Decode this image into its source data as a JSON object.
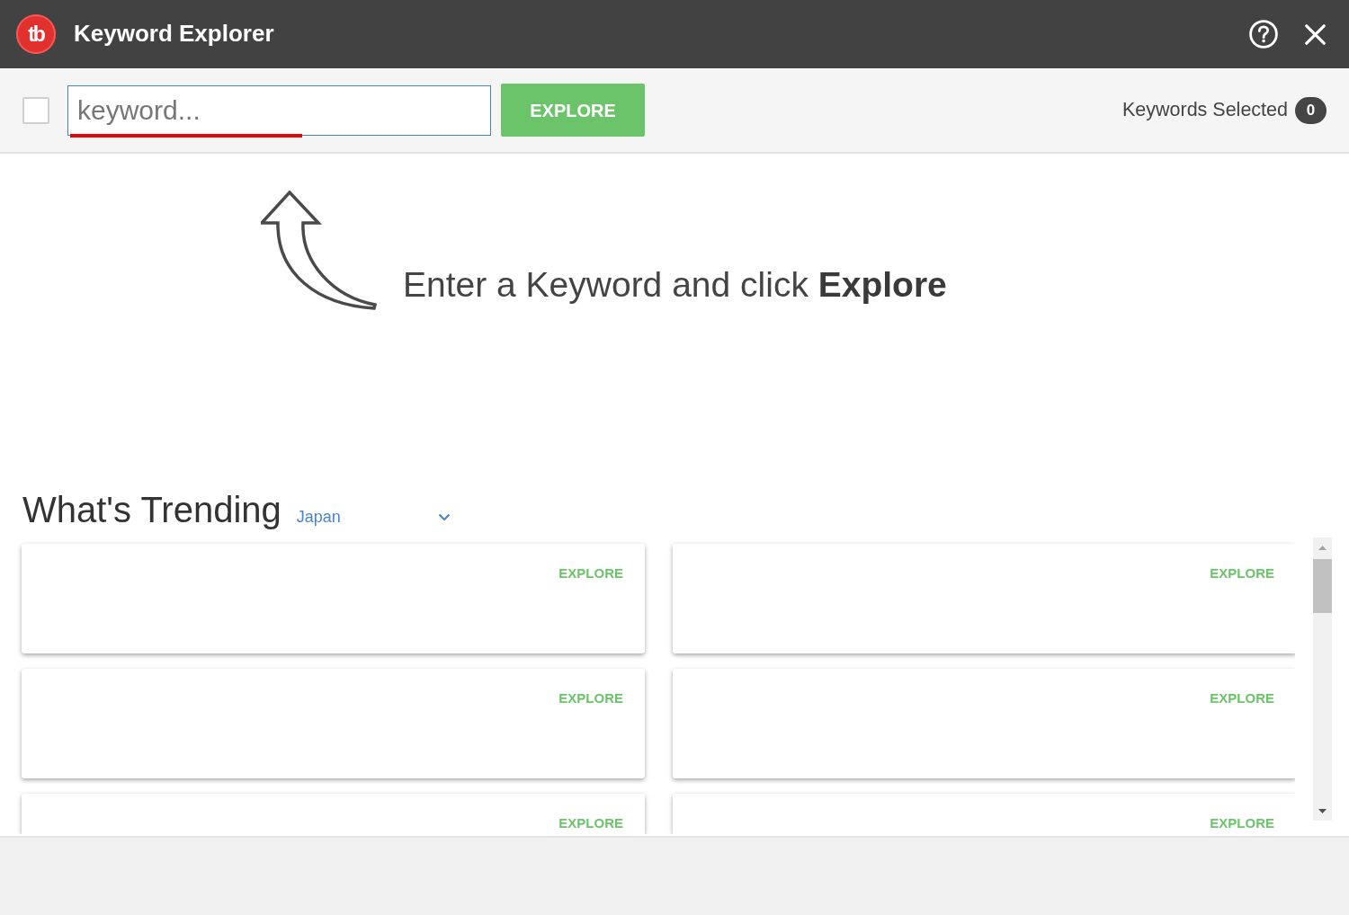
{
  "window": {
    "title": "Keyword Explorer",
    "logo_text": "tb"
  },
  "toolbar": {
    "select_all": {
      "checked": false
    },
    "search": {
      "placeholder": "keyword...",
      "underlined": true
    },
    "explore_button": "EXPLORE",
    "selected_label": "Keywords Selected",
    "selected_count": "0"
  },
  "hint": "Enter a Keyword and click **Explore**",
  "trending": {
    "title": "What's Trending",
    "country": "Japan",
    "cards": [
      {
        "action": "EXPLORE"
      },
      {
        "action": "EXPLORE"
      },
      {
        "action": "EXPLORE"
      },
      {
        "action": "EXPLORE"
      },
      {
        "action": "EXPLORE"
      },
      {
        "action": "EXPLORE"
      }
    ]
  }
}
